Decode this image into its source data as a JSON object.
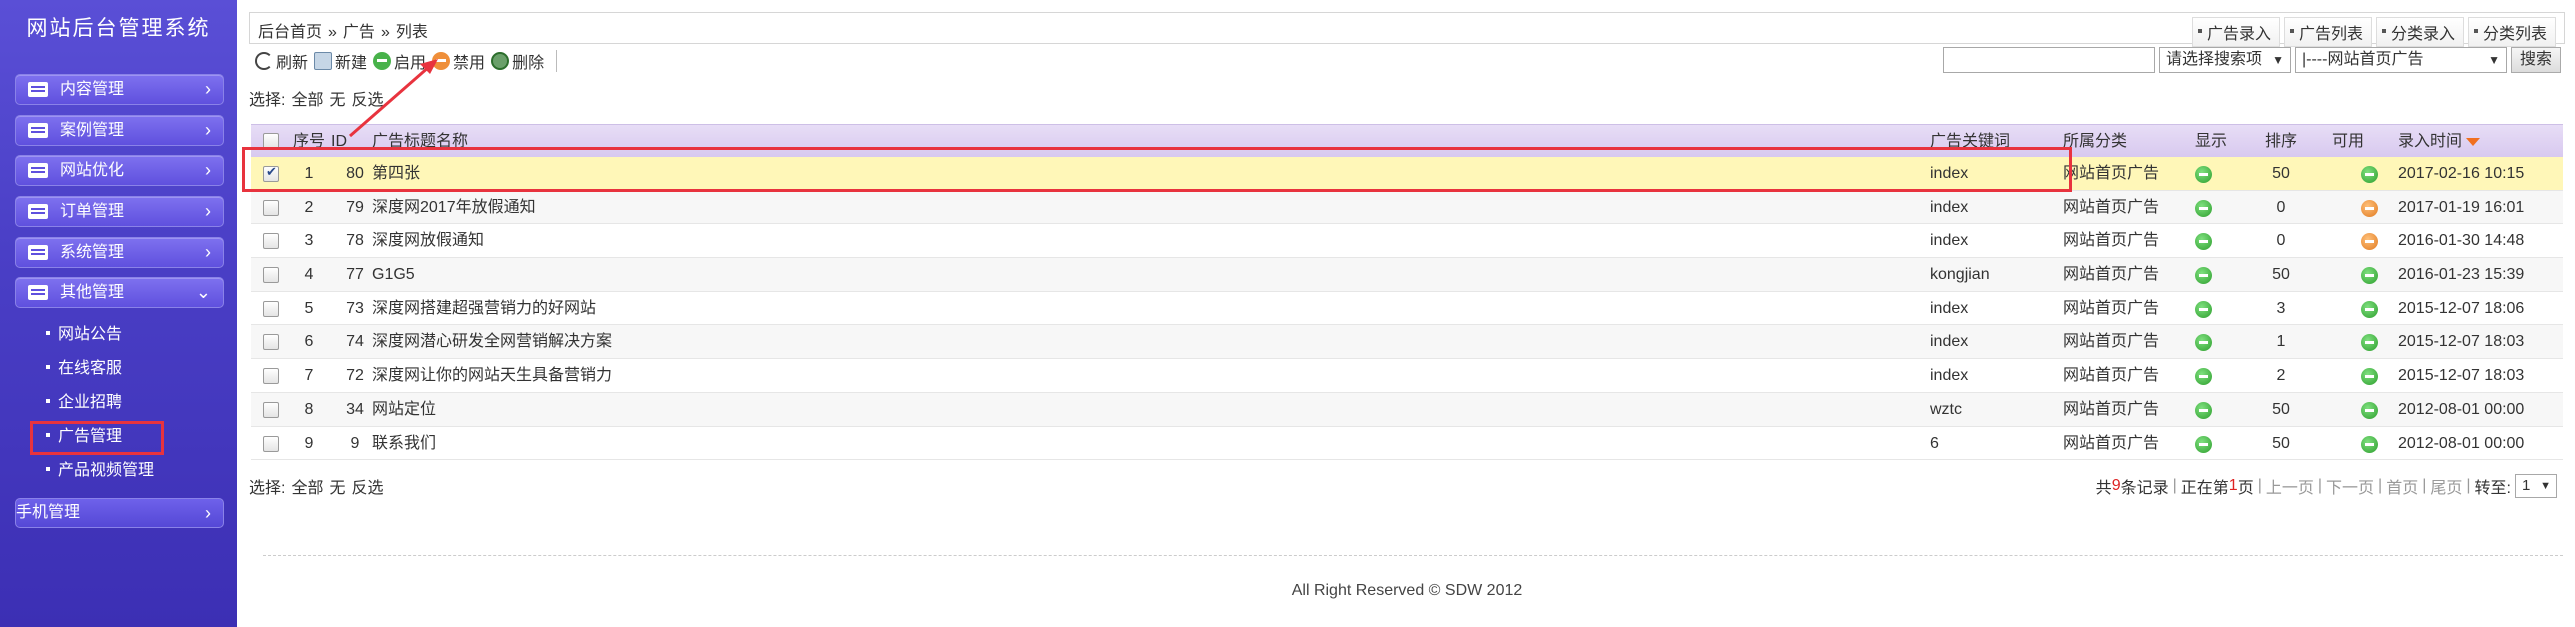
{
  "sidebar": {
    "brand": "网站后台管理系统",
    "menus": [
      "内容管理",
      "案例管理",
      "网站优化",
      "订单管理",
      "系统管理",
      "其他管理"
    ],
    "submenus": [
      "网站公告",
      "在线客服",
      "企业招聘",
      "广告管理",
      "产品视频管理"
    ],
    "mobile_menu": "手机管理",
    "arrow_right": "›",
    "arrow_down": "⌄"
  },
  "header": {
    "breadcrumb": [
      "后台首页",
      "»",
      "广告",
      "»",
      "列表"
    ],
    "quick_links": [
      "广告录入",
      "广告列表",
      "分类录入",
      "分类列表"
    ]
  },
  "toolbar": {
    "refresh": "刷新",
    "new": "新建",
    "enable": "启用",
    "disable": "禁用",
    "delete": "删除"
  },
  "search": {
    "input_value": "",
    "field_select": "请选择搜索项",
    "category_select": "|----网站首页广告",
    "button": "搜索"
  },
  "selection": {
    "label": "选择:",
    "all": "全部",
    "none": "无",
    "invert": "反选"
  },
  "table": {
    "columns": [
      "序号",
      "ID",
      "广告标题名称",
      "广告关键词",
      "所属分类",
      "显示",
      "排序",
      "可用",
      "录入时间"
    ],
    "rows": [
      {
        "no": "1",
        "id": "80",
        "title": "第四张",
        "keyword": "index",
        "category": "网站首页广告",
        "show": "ok",
        "order": "50",
        "usable": "ok",
        "time": "2017-02-16 10:15",
        "checked": true
      },
      {
        "no": "2",
        "id": "79",
        "title": "深度网2017年放假通知",
        "keyword": "index",
        "category": "网站首页广告",
        "show": "ok",
        "order": "0",
        "usable": "no",
        "time": "2017-01-19 16:01",
        "checked": false
      },
      {
        "no": "3",
        "id": "78",
        "title": "深度网放假通知",
        "keyword": "index",
        "category": "网站首页广告",
        "show": "ok",
        "order": "0",
        "usable": "no",
        "time": "2016-01-30 14:48",
        "checked": false
      },
      {
        "no": "4",
        "id": "77",
        "title": "G1G5",
        "keyword": "kongjian",
        "category": "网站首页广告",
        "show": "ok",
        "order": "50",
        "usable": "ok",
        "time": "2016-01-23 15:39",
        "checked": false
      },
      {
        "no": "5",
        "id": "73",
        "title": "深度网搭建超强营销力的好网站",
        "keyword": "index",
        "category": "网站首页广告",
        "show": "ok",
        "order": "3",
        "usable": "ok",
        "time": "2015-12-07 18:06",
        "checked": false
      },
      {
        "no": "6",
        "id": "74",
        "title": "深度网潜心研发全网营销解决方案",
        "keyword": "index",
        "category": "网站首页广告",
        "show": "ok",
        "order": "1",
        "usable": "ok",
        "time": "2015-12-07 18:03",
        "checked": false
      },
      {
        "no": "7",
        "id": "72",
        "title": "深度网让你的网站天生具备营销力",
        "keyword": "index",
        "category": "网站首页广告",
        "show": "ok",
        "order": "2",
        "usable": "ok",
        "time": "2015-12-07 18:03",
        "checked": false
      },
      {
        "no": "8",
        "id": "34",
        "title": "网站定位",
        "keyword": "wztc",
        "category": "网站首页广告",
        "show": "ok",
        "order": "50",
        "usable": "ok",
        "time": "2012-08-01 00:00",
        "checked": false
      },
      {
        "no": "9",
        "id": "9",
        "title": "联系我们",
        "keyword": "6",
        "category": "网站首页广告",
        "show": "ok",
        "order": "50",
        "usable": "ok",
        "time": "2012-08-01 00:00",
        "checked": false
      }
    ]
  },
  "pager": {
    "prefix": "共",
    "total": "9",
    "records": "条记录",
    "current_prefix": "正在第",
    "current": "1",
    "page_suffix": "页",
    "prev": "上一页",
    "next": "下一页",
    "first": "首页",
    "last": "尾页",
    "goto": "转至:",
    "select_value": "1"
  },
  "footer": "All Right Reserved © SDW 2012",
  "colors": {
    "highlight": "#e8333e",
    "selected_row": "#fff7b8",
    "sidebar": "#4a3fc6"
  }
}
